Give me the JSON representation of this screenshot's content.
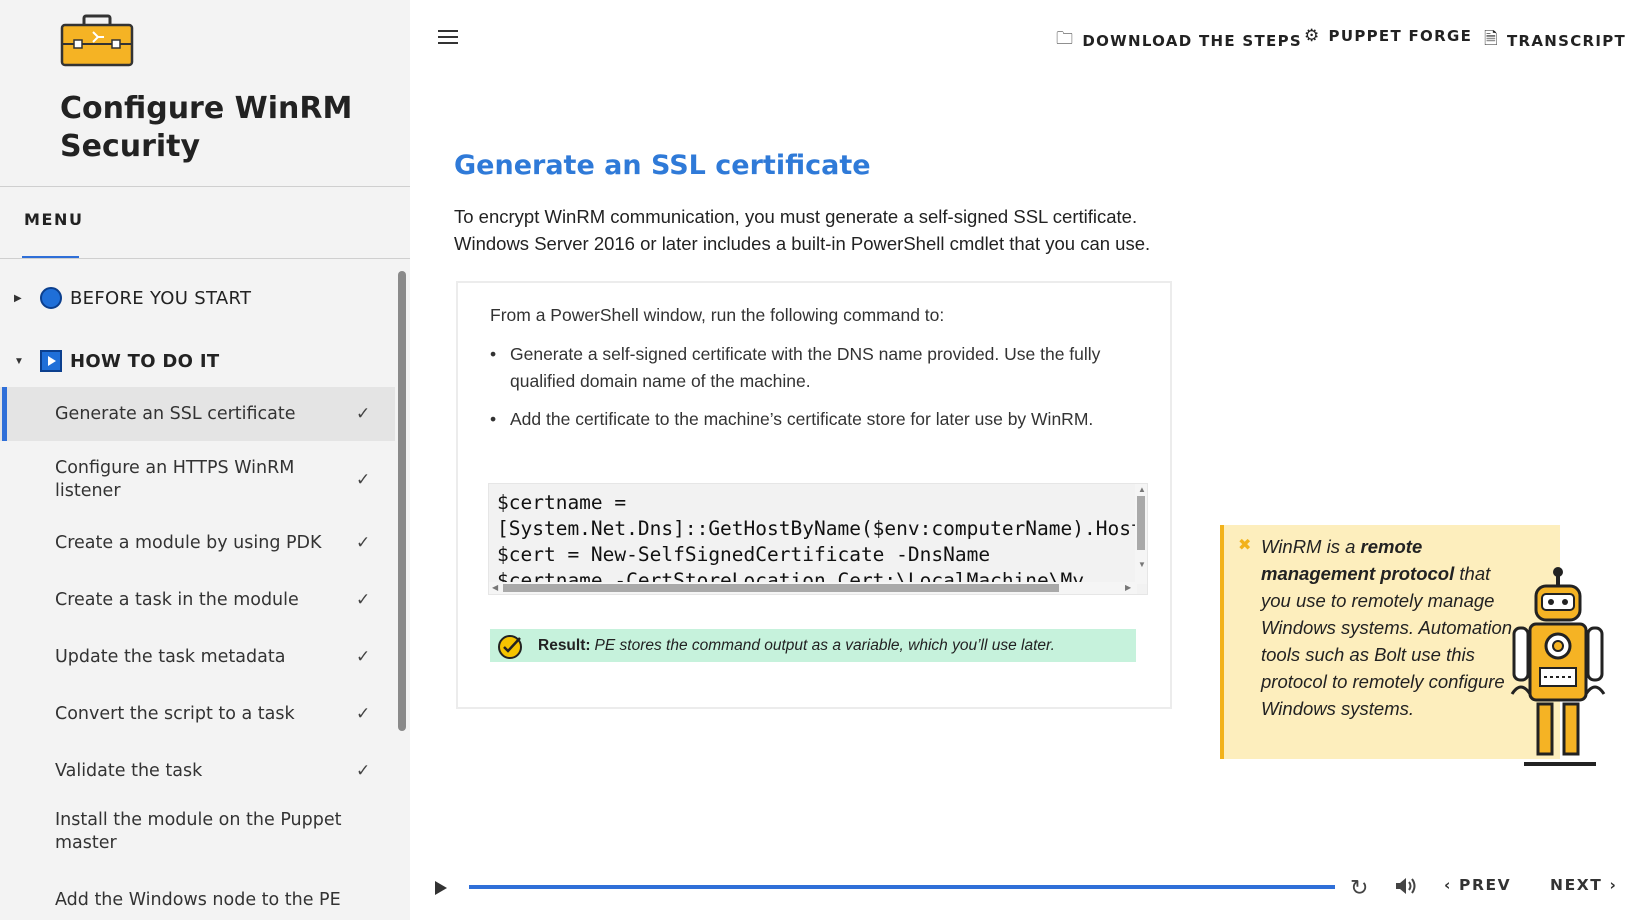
{
  "course": {
    "title": "Configure WinRM Security"
  },
  "menu": {
    "tab_label": "MENU"
  },
  "sections": [
    {
      "label": "BEFORE YOU START"
    },
    {
      "label": "HOW TO DO IT"
    }
  ],
  "lessons": [
    {
      "label": "Generate an SSL certificate",
      "check": "✓"
    },
    {
      "label": "Configure an HTTPS WinRM listener",
      "check": "✓"
    },
    {
      "label": "Create a module by using PDK",
      "check": "✓"
    },
    {
      "label": "Create a task in the module",
      "check": "✓"
    },
    {
      "label": "Update the task metadata",
      "check": "✓"
    },
    {
      "label": "Convert the script to a task",
      "check": "✓"
    },
    {
      "label": "Validate the task",
      "check": "✓"
    },
    {
      "label": "Install the module on the Puppet master",
      "check": ""
    },
    {
      "label": "Add the Windows node to the PE",
      "check": ""
    }
  ],
  "header": {
    "download_label": "DOWNLOAD THE STEPS",
    "forge_label": "PUPPET FORGE",
    "transcript_label": "TRANSCRIPT"
  },
  "content": {
    "title": "Generate an SSL certificate",
    "intro_line1": "To encrypt WinRM communication, you must generate a self-signed SSL certificate.",
    "intro_line2": "Windows Server 2016 or later includes a built-in PowerShell cmdlet that you can use.",
    "lead": "From a PowerShell window, run the following command to:",
    "bullets": [
      "Generate a self-signed certificate with the DNS name provided. Use the fully qualified domain name of the machine.",
      "Add the certificate to the machine’s certificate store for later use by WinRM."
    ],
    "code": "$certname =\n[System.Net.Dns]::GetHostByName($env:computerName).HostName\n$cert = New-SelfSignedCertificate -DnsName\n$certname -CertStoreLocation Cert:\\LocalMachine\\My",
    "result_label": "Result:",
    "result_text": "PE stores the command output as a variable, which you’ll use later."
  },
  "callout": {
    "close": "✖",
    "text_pre": "WinRM is a ",
    "text_bold": "remote management protocol",
    "text_post": " that you use to remotely manage Windows systems. Automation tools such as Bolt use this protocol to remotely configure Windows systems."
  },
  "player": {
    "progress": 1.0,
    "prev_label": "PREV",
    "next_label": "NEXT",
    "prev_arrow": "‹",
    "next_arrow": "›"
  },
  "colors": {
    "accent": "#2f6fd8",
    "title_blue": "#2f7ad8",
    "callout_bg": "#fdeebd",
    "callout_border": "#f2b21b",
    "result_bg": "#c6f2dc"
  }
}
